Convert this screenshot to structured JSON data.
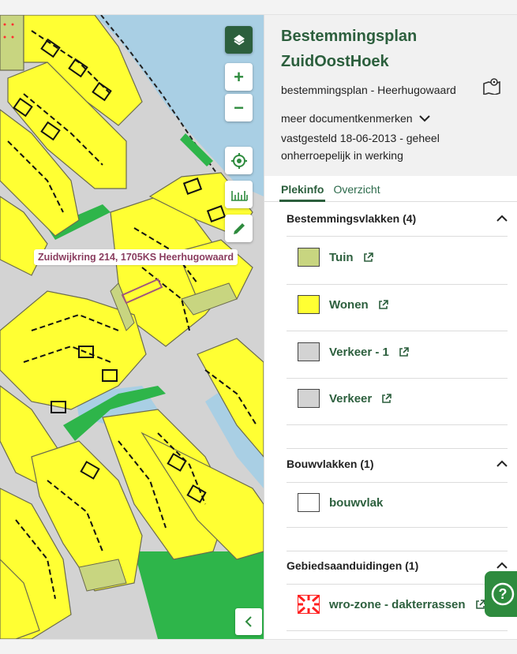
{
  "map": {
    "address_label": "Zuidwijkring 214, 1705KS Heerhugowaard",
    "controls": {
      "layers": "layers-icon",
      "zoom_in": "+",
      "zoom_out": "−",
      "locate": "locate-icon",
      "measure": "measure-icon",
      "draw": "pencil-icon",
      "collapse": "‹"
    },
    "colors": {
      "wonen": "#ffff33",
      "tuin": "#c8d580",
      "verkeer": "#d3d3d3",
      "water": "#a9cfe4",
      "groen": "#2eb54a",
      "plot_outline": "#6b6b4e",
      "selected_outline": "#a0567d"
    }
  },
  "panel": {
    "title": "Bestemmingsplan ZuidOostHoek",
    "subtitle": "bestemmingsplan - Heerhugowaard",
    "meer": "meer documentkenmerken",
    "status": "vastgesteld 18-06-2013 - geheel onherroepelijk in werking",
    "tabs": [
      {
        "label": "Plekinfo",
        "active": true
      },
      {
        "label": "Overzicht",
        "active": false
      }
    ],
    "sections": [
      {
        "title": "Bestemmingsvlakken (4)",
        "items": [
          {
            "label": "Tuin",
            "color": "#c8d580"
          },
          {
            "label": "Wonen",
            "color": "#ffff33"
          },
          {
            "label": "Verkeer - 1",
            "color": "#d3d3d3"
          },
          {
            "label": "Verkeer",
            "color": "#d3d3d3"
          }
        ]
      },
      {
        "title": "Bouwvlakken (1)",
        "items": [
          {
            "label": "bouwvlak",
            "color": "#ffffff"
          }
        ]
      },
      {
        "title": "Gebiedsaanduidingen (1)",
        "items": [
          {
            "label": "wro-zone - dakterrassen",
            "color": "#ff2020"
          }
        ]
      }
    ]
  },
  "help": {
    "label": "?"
  }
}
